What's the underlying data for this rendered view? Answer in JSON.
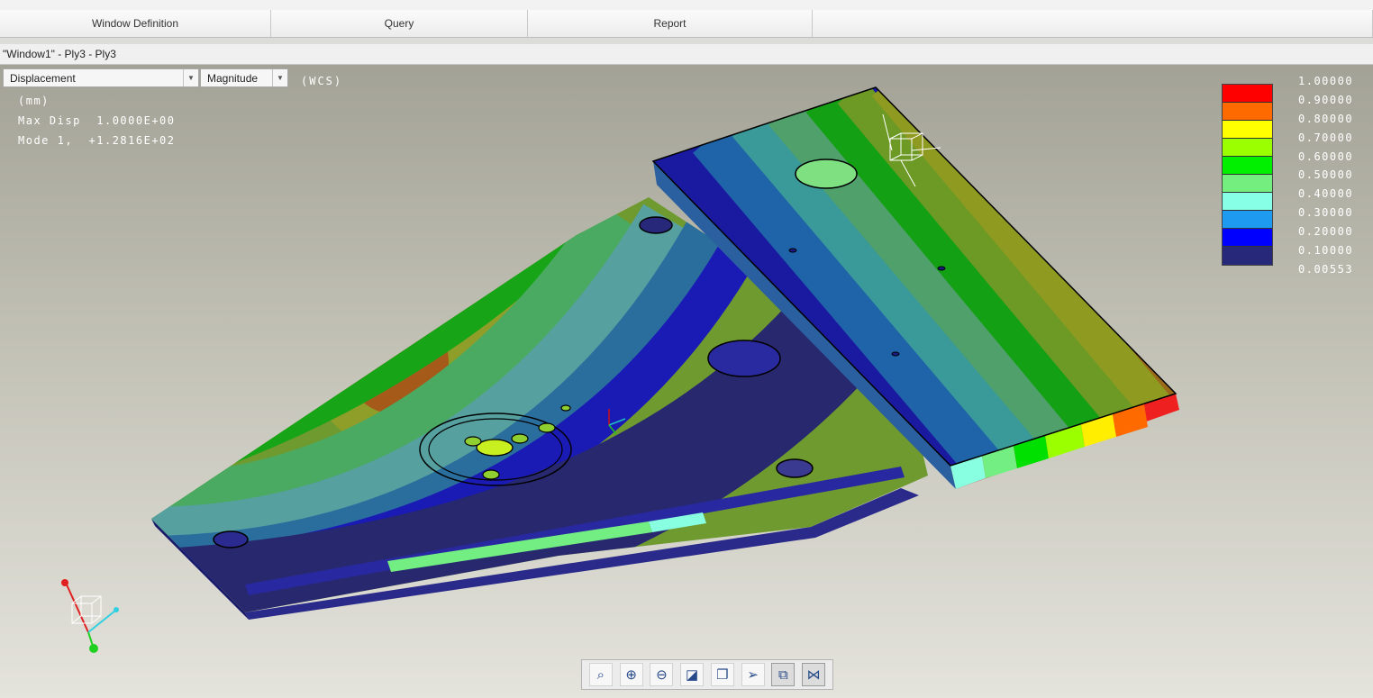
{
  "ribbon": {
    "groups": [
      {
        "label": "Window Definition",
        "width": 301
      },
      {
        "label": "Query",
        "width": 285
      },
      {
        "label": "Report",
        "width": 316
      },
      {
        "label": "",
        "width": 622
      }
    ]
  },
  "window": {
    "title": "\"Window1\" - Ply3 - Ply3"
  },
  "controls": {
    "quantity": "Displacement",
    "component": "Magnitude",
    "csys": "(WCS)"
  },
  "info": {
    "units": "(mm)",
    "max_disp": "Max Disp  1.0000E+00",
    "mode": "Mode 1,  +1.2816E+02"
  },
  "legend": {
    "colors": [
      "#ff0000",
      "#ff6a00",
      "#ffff00",
      "#9bff00",
      "#00f000",
      "#73ee7f",
      "#86ffe6",
      "#1e9bf0",
      "#0000ff",
      "#28287a"
    ],
    "values": [
      "1.00000",
      "0.90000",
      "0.80000",
      "0.70000",
      "0.60000",
      "0.50000",
      "0.40000",
      "0.30000",
      "0.20000",
      "0.10000",
      "0.00553"
    ]
  },
  "toolbar": {
    "icons": [
      {
        "name": "refit-icon",
        "glyph": "⌕"
      },
      {
        "name": "zoom-in-icon",
        "glyph": "⊕"
      },
      {
        "name": "zoom-out-icon",
        "glyph": "⊖"
      },
      {
        "name": "repaint-icon",
        "glyph": "◪"
      },
      {
        "name": "saved-views-icon",
        "glyph": "❐"
      },
      {
        "name": "spin-center-icon",
        "glyph": "➢"
      },
      {
        "name": "display-style-icon",
        "glyph": "⧉"
      },
      {
        "name": "datum-display-icon",
        "glyph": "⋈"
      }
    ],
    "active": [
      6,
      7
    ]
  }
}
